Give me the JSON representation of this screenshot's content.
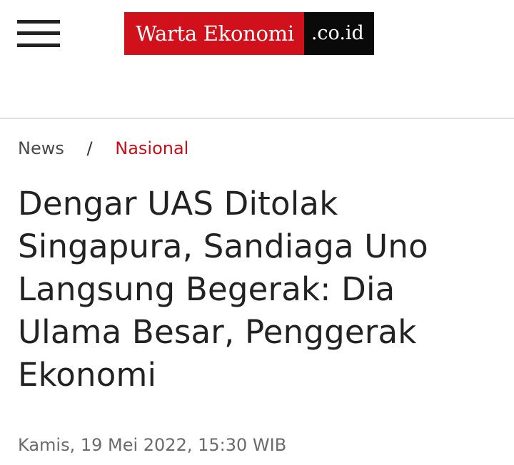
{
  "header": {
    "menu_icon": "hamburger-menu-icon",
    "logo": {
      "name": "Warta Ekonomi",
      "tld": ".co.id",
      "colors": {
        "main_bg": "#d0111b",
        "tld_bg": "#0a0a0a",
        "text": "#ffffff"
      }
    }
  },
  "breadcrumb": {
    "home": "News",
    "separator": "/",
    "current": "Nasional",
    "current_color": "#c4101a"
  },
  "article": {
    "title": "Dengar UAS Ditolak Singapura, Sandiaga Uno Langsung Begerak: Dia Ulama Besar, Penggerak Ekonomi",
    "date": "Kamis, 19 Mei 2022, 15:30 WIB"
  }
}
